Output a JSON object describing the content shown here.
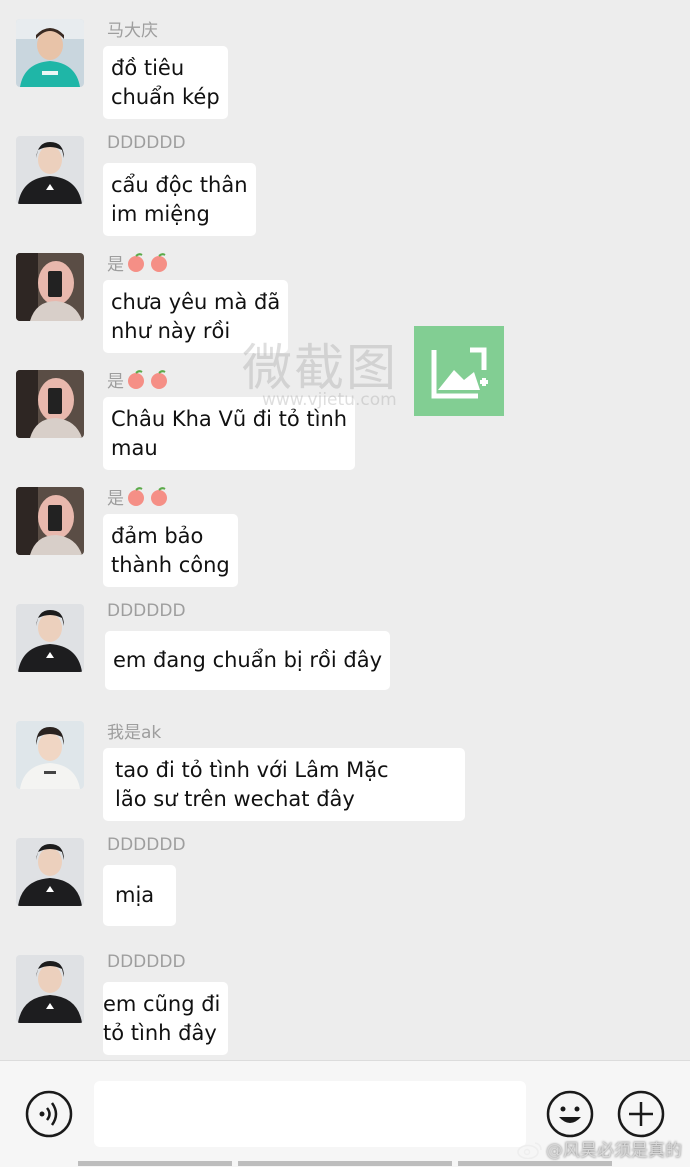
{
  "messages": [
    {
      "sender": "马大庆",
      "text": "đồ tiêu\nchuẩn kép",
      "avatar": "teal-hoodie-boy"
    },
    {
      "sender": "DDDDDD",
      "text": "cẩu độc thân\nim miệng",
      "avatar": "black-shirt-boy"
    },
    {
      "sender": "是",
      "text": "chưa yêu mà đã\nnhư này rồi",
      "avatar": "pink-hair-mirror-selfie"
    },
    {
      "sender": "是",
      "text": "Châu Kha Vũ đi tỏ tình\nmau",
      "avatar": "pink-hair-mirror-selfie"
    },
    {
      "sender": "是",
      "text": "đảm bảo\nthành công",
      "avatar": "pink-hair-mirror-selfie"
    },
    {
      "sender": "DDDDDD",
      "text": "em đang chuẩn bị rồi đây",
      "avatar": "black-shirt-boy"
    },
    {
      "sender": "我是ak",
      "text": "tao đi tỏ tình với Lâm Mặc\nlão sư trên wechat đây",
      "avatar": "white-shirt-boy"
    },
    {
      "sender": "DDDDDD",
      "text": "mịa",
      "avatar": "black-shirt-boy"
    },
    {
      "sender": "DDDDDD",
      "text": "em cũng đi\ntỏ tình đây",
      "avatar": "black-shirt-boy"
    }
  ],
  "watermark": {
    "text": "微截图",
    "url": "www.vjietu.com"
  },
  "input_bar": {
    "voice_icon": "voice-icon",
    "emoji_icon": "emoji-icon",
    "plus_icon": "plus-icon",
    "input_value": ""
  },
  "weibo_watermark": "@风昊必须是真的",
  "colors": {
    "background": "#ededed",
    "bubble": "#ffffff",
    "sender_name": "#9e9e9e",
    "watermark_logo": "#6ec882"
  }
}
